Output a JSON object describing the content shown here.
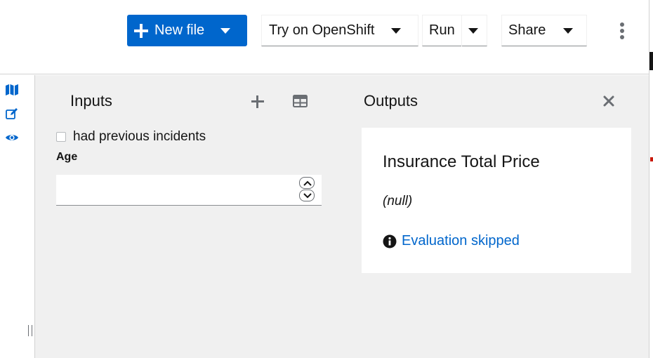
{
  "toolbar": {
    "new_file_label": "New file",
    "try_label": "Try on OpenShift",
    "run_label": "Run",
    "share_label": "Share"
  },
  "rail": {
    "icons": [
      "map-icon",
      "edit-icon",
      "eye-icon"
    ],
    "accent": "#0066cc"
  },
  "inputs": {
    "title": "Inputs",
    "checkbox_label": "had previous incidents",
    "checkbox_checked": false,
    "age_label": "Age",
    "age_value": ""
  },
  "outputs": {
    "title": "Outputs",
    "card_title": "Insurance Total Price",
    "card_value": "(null)",
    "status_text": "Evaluation skipped"
  },
  "colors": {
    "primary": "#0066cc",
    "panel_bg": "#f0f0f0",
    "text": "#151515"
  }
}
